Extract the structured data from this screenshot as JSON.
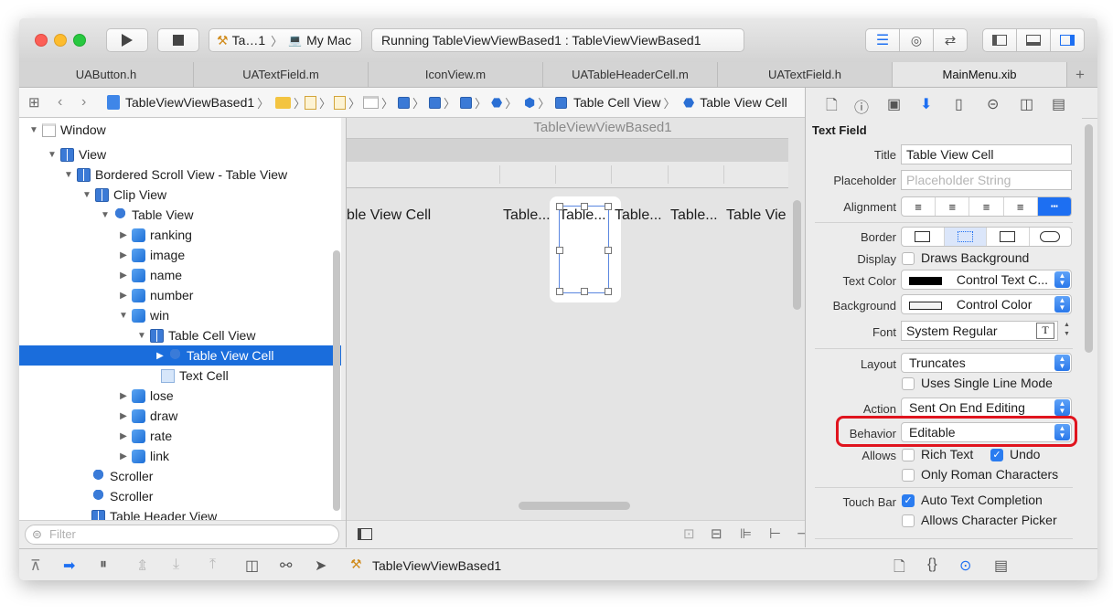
{
  "toolbar": {
    "scheme_name": "Ta…1",
    "destination": "My Mac",
    "activity_status": "Running TableViewViewBased1 : TableViewViewBased1"
  },
  "tabs": [
    {
      "label": "UAButton.h"
    },
    {
      "label": "UATextField.m"
    },
    {
      "label": "IconView.m"
    },
    {
      "label": "UATableHeaderCell.m"
    },
    {
      "label": "UATextField.h"
    },
    {
      "label": "MainMenu.xib"
    }
  ],
  "jumpbar": {
    "project": "TableViewViewBased1",
    "table_cell_view": "Table Cell View",
    "table_view_cell": "Table View Cell"
  },
  "outline": {
    "window": "Window",
    "view": "View",
    "bordered_scroll_view": "Bordered Scroll View - Table View",
    "clip_view": "Clip View",
    "table_view": "Table View",
    "columns": [
      "ranking",
      "image",
      "name",
      "number",
      "win"
    ],
    "table_cell_view": "Table Cell View",
    "table_view_cell": "Table View Cell",
    "text_cell": "Text Cell",
    "columns_after": [
      "lose",
      "draw",
      "rate",
      "link"
    ],
    "scroller_1": "Scroller",
    "scroller_2": "Scroller",
    "partial": "Table Header View"
  },
  "filter": {
    "placeholder": "Filter"
  },
  "canvas": {
    "window_title": "TableViewViewBased1",
    "cell_1": "ble View Cell",
    "cell_2": "Table...",
    "cell_3": "Table...",
    "cell_4": "Table...",
    "cell_5": "Table...",
    "cell_6": "Table Vie"
  },
  "inspector": {
    "section": "Text Field",
    "title_label": "Title",
    "title_value": "Table View Cell",
    "placeholder_label": "Placeholder",
    "placeholder_value": "Placeholder String",
    "alignment_label": "Alignment",
    "border_label": "Border",
    "display_label": "Display",
    "draws_background": "Draws Background",
    "text_color_label": "Text Color",
    "text_color_value": "Control Text C...",
    "background_label": "Background",
    "background_value": "Control Color",
    "font_label": "Font",
    "font_value": "System Regular",
    "layout_label": "Layout",
    "layout_value": "Truncates",
    "single_line": "Uses Single Line Mode",
    "action_label": "Action",
    "action_value": "Sent On End Editing",
    "behavior_label": "Behavior",
    "behavior_value": "Editable",
    "allows_label": "Allows",
    "rich_text": "Rich Text",
    "undo": "Undo",
    "only_roman": "Only Roman Characters",
    "touch_bar_label": "Touch Bar",
    "auto_completion": "Auto Text Completion",
    "char_picker": "Allows Character Picker"
  },
  "bottombar": {
    "scheme_label": "TableViewViewBased1"
  },
  "colors": {
    "accent": "#1a6ddc",
    "highlight": "#e0141e"
  }
}
